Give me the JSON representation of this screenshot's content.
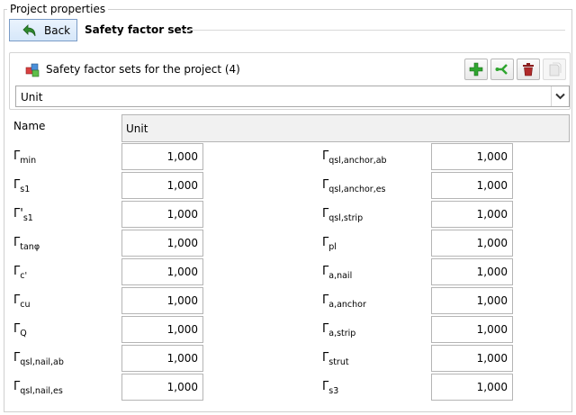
{
  "group": {
    "caption": "Project properties"
  },
  "header": {
    "back_label": "Back",
    "title": "Safety factor sets"
  },
  "sets": {
    "label": "Safety factor sets for the project (4)",
    "selected": "Unit"
  },
  "name": {
    "label": "Name",
    "value": "Unit"
  },
  "left_params": [
    {
      "symbol": "Γ",
      "sub": "min",
      "value": "1,000"
    },
    {
      "symbol": "Γ",
      "sub": "s1",
      "value": "1,000"
    },
    {
      "symbol": "Γ'",
      "sub": "s1",
      "value": "1,000"
    },
    {
      "symbol": "Γ",
      "sub": "tanφ",
      "value": "1,000"
    },
    {
      "symbol": "Γ",
      "sub": "c'",
      "value": "1,000"
    },
    {
      "symbol": "Γ",
      "sub": "cu",
      "value": "1,000"
    },
    {
      "symbol": "Γ",
      "sub": "Q",
      "value": "1,000"
    },
    {
      "symbol": "Γ",
      "sub": "qsl,nail,ab",
      "value": "1,000"
    },
    {
      "symbol": "Γ",
      "sub": "qsl,nail,es",
      "value": "1,000"
    }
  ],
  "right_params": [
    {
      "symbol": "Γ",
      "sub": "qsl,anchor,ab",
      "value": "1,000"
    },
    {
      "symbol": "Γ",
      "sub": "qsl,anchor,es",
      "value": "1,000"
    },
    {
      "symbol": "Γ",
      "sub": "qsl,strip",
      "value": "1,000"
    },
    {
      "symbol": "Γ",
      "sub": "pl",
      "value": "1,000"
    },
    {
      "symbol": "Γ",
      "sub": "a,nail",
      "value": "1,000"
    },
    {
      "symbol": "Γ",
      "sub": "a,anchor",
      "value": "1,000"
    },
    {
      "symbol": "Γ",
      "sub": "a,strip",
      "value": "1,000"
    },
    {
      "symbol": "Γ",
      "sub": "strut",
      "value": "1,000"
    },
    {
      "symbol": "Γ",
      "sub": "s3",
      "value": "1,000"
    }
  ]
}
